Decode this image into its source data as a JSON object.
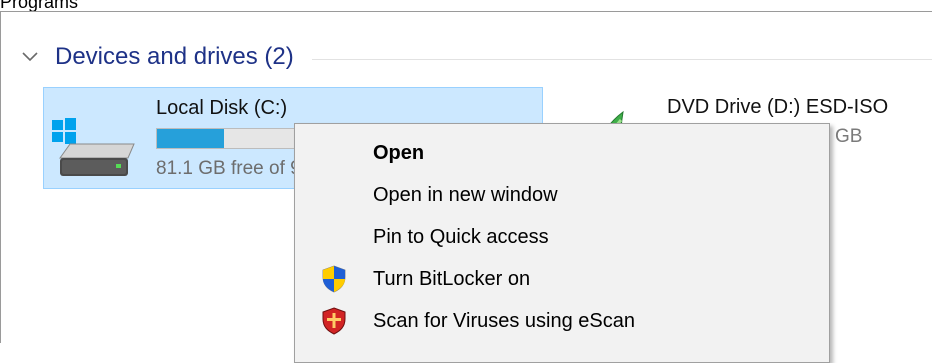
{
  "top_label": "Programs",
  "group": {
    "title": "Devices and drives (2)"
  },
  "drives": {
    "local_disk": {
      "name": "Local Disk (C:)",
      "free_text": "81.1 GB free of 99.8 GB",
      "usage_fraction": 0.18,
      "accent_color": "#26a0da"
    },
    "dvd": {
      "name": "DVD Drive (D:) ESD-ISO",
      "size_text": "0 bytes free of 4.33 GB"
    }
  },
  "context_menu": {
    "items": [
      {
        "label": "Open",
        "bold": true,
        "icon": ""
      },
      {
        "label": "Open in new window",
        "bold": false,
        "icon": ""
      },
      {
        "label": "Pin to Quick access",
        "bold": false,
        "icon": ""
      },
      {
        "label": "Turn BitLocker on",
        "bold": false,
        "icon": "uac-shield-icon"
      },
      {
        "label": "Scan for Viruses using eScan",
        "bold": false,
        "icon": "escan-shield-icon"
      }
    ]
  },
  "colors": {
    "selection_background": "#cce8ff",
    "selection_border": "#99d1ff",
    "group_title": "#1e3287"
  }
}
